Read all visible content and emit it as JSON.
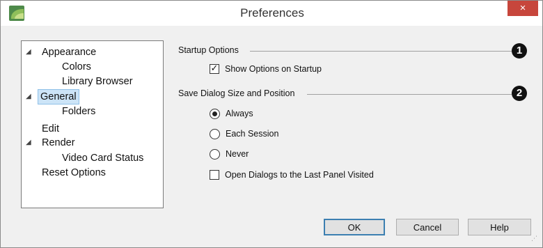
{
  "window": {
    "title": "Preferences",
    "close_glyph": "×"
  },
  "tree": {
    "items": [
      {
        "label": "Appearance",
        "expander": "◢"
      },
      {
        "label": "Colors"
      },
      {
        "label": "Library Browser"
      },
      {
        "label": "General",
        "expander": "◢",
        "selected": true
      },
      {
        "label": "Folders"
      },
      {
        "label": "Edit"
      },
      {
        "label": "Render",
        "expander": "◢"
      },
      {
        "label": "Video Card Status"
      },
      {
        "label": "Reset Options"
      }
    ]
  },
  "startup": {
    "title": "Startup Options",
    "badge": "1",
    "show_options": {
      "label": "Show Options on Startup",
      "checked": true,
      "mark": "✓"
    }
  },
  "save_dialog": {
    "title": "Save Dialog Size and Position",
    "badge": "2",
    "options": [
      {
        "label": "Always",
        "selected": true
      },
      {
        "label": "Each Session",
        "selected": false
      },
      {
        "label": "Never",
        "selected": false
      }
    ],
    "open_last_panel": {
      "label": "Open Dialogs to the Last Panel Visited",
      "checked": false
    }
  },
  "buttons": {
    "ok": "OK",
    "cancel": "Cancel",
    "help": "Help"
  },
  "colors": {
    "close_button": "#c7463c",
    "selection": "#cce4f7",
    "default_button_border": "#3c7fb1"
  }
}
